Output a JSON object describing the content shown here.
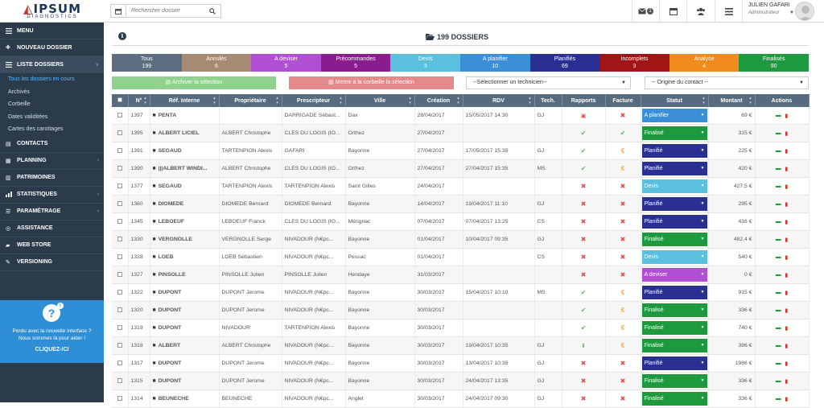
{
  "topbar": {
    "brand": "IPSUM",
    "brand_sub": "DIAGNOSTICS",
    "search_placeholder": "Rechercher dossier",
    "mail_count": "1",
    "user_name": "JULIEN GAFARI",
    "user_role": "Administrateur"
  },
  "sidebar": {
    "items": [
      {
        "label": "MENU",
        "icon": "menu-icon"
      },
      {
        "label": "NOUVEAU DOSSIER",
        "icon": "plus-icon"
      },
      {
        "label": "LISTE DOSSIERS",
        "icon": "list-icon"
      },
      {
        "label": "CONTACTS",
        "icon": "contact-icon"
      },
      {
        "label": "PLANNING",
        "icon": "calendar-icon"
      },
      {
        "label": "PATRIMOINES",
        "icon": "building-icon"
      },
      {
        "label": "STATISTIQUES",
        "icon": "chart-icon"
      },
      {
        "label": "PARAMÉTRAGE",
        "icon": "sliders-icon"
      },
      {
        "label": "ASSISTANCE",
        "icon": "lifebuoy-icon"
      },
      {
        "label": "WEB STORE",
        "icon": "cart-icon"
      },
      {
        "label": "VERSIONING",
        "icon": "wrench-icon"
      }
    ],
    "sub_items": [
      "Tous les dossiers en cours",
      "Archivés",
      "Corbeille",
      "Dates validitées",
      "Cartes des carottages"
    ],
    "help_line1": "Perdu avec la nouvelle interface ?",
    "help_line2": "Nous sommes là pour aider !",
    "help_cta": "CLIQUEZ-ICI"
  },
  "main": {
    "heading": "199 DOSSIERS",
    "archive_label": "Archiver la sélection",
    "trash_label": "Mettre à la corbeille la sélection",
    "tech_select": "--Sélectionner un technicien--",
    "origin_select": "-- Origine du contact --"
  },
  "statuses": [
    {
      "label": "Tous",
      "count": "199",
      "color": "#5d6e80"
    },
    {
      "label": "Annulés",
      "count": "6",
      "color": "#a68b72"
    },
    {
      "label": "A deviser",
      "count": "5",
      "color": "#b14fd4"
    },
    {
      "label": "Précommandes",
      "count": "5",
      "color": "#8a1c8f"
    },
    {
      "label": "Devis",
      "count": "3",
      "color": "#5bc0de"
    },
    {
      "label": "A planifier",
      "count": "10",
      "color": "#3a8fd8"
    },
    {
      "label": "Planifiés",
      "count": "69",
      "color": "#2a2f93"
    },
    {
      "label": "Incomplets",
      "count": "3",
      "color": "#a01616"
    },
    {
      "label": "Analyse",
      "count": "4",
      "color": "#f28b1e"
    },
    {
      "label": "Finalisés",
      "count": "90",
      "color": "#1c9a3d"
    }
  ],
  "columns": [
    "",
    "N°",
    "Réf. Interne",
    "Propriétaire",
    "Prescripteur",
    "Ville",
    "Création",
    "RDV",
    "Tech.",
    "Rapports",
    "Facture",
    "Statut",
    "Montant",
    "Actions"
  ],
  "rows": [
    {
      "num": "1397",
      "ref": "PENTA",
      "prop": "",
      "presc": "DARRIGADE Sébast...",
      "ville": "Dax",
      "creation": "28/04/2017",
      "rdv": "15/05/2017 14:30",
      "tech": "GJ",
      "rapport": "lock",
      "facture": "x",
      "statut": "A planifier",
      "scolor": "#3a8fd8",
      "montant": "69 €"
    },
    {
      "num": "1395",
      "ref": "ALBERT LICIEL",
      "prop": "ALBERT Christophe",
      "presc": "CLES DU LOGIS (IO...",
      "ville": "Orthez",
      "creation": "27/04/2017",
      "rdv": "",
      "tech": "",
      "rapport": "ok",
      "facture": "ok",
      "statut": "Finalisé",
      "scolor": "#1c9a3d",
      "montant": "315 €"
    },
    {
      "num": "1391",
      "ref": "SEGAUD",
      "prop": "TARTENPION Alexis",
      "presc": "GAFARI",
      "ville": "Bayonne",
      "creation": "27/04/2017",
      "rdv": "17/05/2017 15:35",
      "tech": "GJ",
      "rapport": "ok",
      "facture": "euro",
      "statut": "Planifié",
      "scolor": "#2a2f93",
      "montant": "225 €"
    },
    {
      "num": "1390",
      "ref": "|||ALBERT WINDI...",
      "prop": "ALBERT Christophe",
      "presc": "CLES DU LOGIS (IO...",
      "ville": "Orthez",
      "creation": "27/04/2017",
      "rdv": "27/04/2017 15:35",
      "tech": "MS",
      "rapport": "ok",
      "facture": "euro",
      "statut": "Planifié",
      "scolor": "#2a2f93",
      "montant": "420 €"
    },
    {
      "num": "1377",
      "ref": "SEGAUD",
      "prop": "TARTENPION Alexis",
      "presc": "TARTENPION Alexis",
      "ville": "Saint Gilles",
      "creation": "24/04/2017",
      "rdv": "",
      "tech": "",
      "rapport": "x",
      "facture": "x",
      "statut": "Devis",
      "scolor": "#5bc0de",
      "montant": "427,5 €"
    },
    {
      "num": "1360",
      "ref": "DIOMEDE",
      "prop": "DIOMEDE Bernard",
      "presc": "DIOMEDE Bernard",
      "ville": "Bayonne",
      "creation": "14/04/2017",
      "rdv": "19/04/2017 11:10",
      "tech": "GJ",
      "rapport": "x",
      "facture": "x",
      "statut": "Planifié",
      "scolor": "#2a2f93",
      "montant": "295 €"
    },
    {
      "num": "1345",
      "ref": "LEBOEUF",
      "prop": "LEBOEUF Franck",
      "presc": "CLES DU LOGIS (IO...",
      "ville": "Mérignac",
      "creation": "07/04/2017",
      "rdv": "07/04/2017 13:25",
      "tech": "CS",
      "rapport": "x",
      "facture": "x",
      "statut": "Planifié",
      "scolor": "#2a2f93",
      "montant": "416 €"
    },
    {
      "num": "1330",
      "ref": "VERGNOLLE",
      "prop": "VERGNOLLE Serge",
      "presc": "NIVADOUR (N€pc...",
      "ville": "Bayonne",
      "creation": "01/04/2017",
      "rdv": "10/04/2017 09:35",
      "tech": "GJ",
      "rapport": "x",
      "facture": "x",
      "statut": "Finalisé",
      "scolor": "#1c9a3d",
      "montant": "482,4 €"
    },
    {
      "num": "1328",
      "ref": "LOEB",
      "prop": "LOEB Sébastien",
      "presc": "NIVADOUR (N€pc...",
      "ville": "Pessac",
      "creation": "01/04/2017",
      "rdv": "",
      "tech": "CS",
      "rapport": "x",
      "facture": "x",
      "statut": "Devis",
      "scolor": "#5bc0de",
      "montant": "540 €"
    },
    {
      "num": "1327",
      "ref": "PINSOLLE",
      "prop": "PINSOLLE Julien",
      "presc": "PINSOLLE Julien",
      "ville": "Hendaye",
      "creation": "31/03/2017",
      "rdv": "",
      "tech": "",
      "rapport": "x",
      "facture": "x",
      "statut": "A deviser",
      "scolor": "#b14fd4",
      "montant": "0 €"
    },
    {
      "num": "1322",
      "ref": "DUPONT",
      "prop": "DUPONT Jerome",
      "presc": "NIVADOUR (N€pc...",
      "ville": "Bayonne",
      "creation": "30/03/2017",
      "rdv": "15/04/2017 10:10",
      "tech": "MS",
      "rapport": "ok",
      "facture": "euro",
      "statut": "Planifié",
      "scolor": "#2a2f93",
      "montant": "915 €"
    },
    {
      "num": "1320",
      "ref": "DUPONT",
      "prop": "DUPONT Jerome",
      "presc": "NIVADOUR (N€pc...",
      "ville": "Bayonne",
      "creation": "30/03/2017",
      "rdv": "",
      "tech": "",
      "rapport": "ok",
      "facture": "euro",
      "statut": "Finalisé",
      "scolor": "#1c9a3d",
      "montant": "336 €"
    },
    {
      "num": "1319",
      "ref": "DUPONT",
      "prop": "NIVADOUR",
      "presc": "TARTENPION Alexis",
      "ville": "Bayonne",
      "creation": "30/03/2017",
      "rdv": "",
      "tech": "",
      "rapport": "ok",
      "facture": "euro",
      "statut": "Finalisé",
      "scolor": "#1c9a3d",
      "montant": "740 €"
    },
    {
      "num": "1318",
      "ref": "ALBERT",
      "prop": "ALBERT Christophe",
      "presc": "NIVADOUR (N€pc...",
      "ville": "Bayonne",
      "creation": "30/03/2017",
      "rdv": "19/04/2017 10:35",
      "tech": "GJ",
      "rapport": "dl",
      "facture": "euro",
      "statut": "Finalisé",
      "scolor": "#1c9a3d",
      "montant": "396 €"
    },
    {
      "num": "1317",
      "ref": "DUPONT",
      "prop": "DUPONT Jerome",
      "presc": "NIVADOUR (N€pc...",
      "ville": "Bayonne",
      "creation": "30/03/2017",
      "rdv": "13/04/2017 10:35",
      "tech": "GJ",
      "rapport": "x",
      "facture": "x",
      "statut": "Planifié",
      "scolor": "#2a2f93",
      "montant": "1986 €"
    },
    {
      "num": "1315",
      "ref": "DUPONT",
      "prop": "DUPONT Jerome",
      "presc": "NIVADOUR (N€pc...",
      "ville": "Bayonne",
      "creation": "30/03/2017",
      "rdv": "24/04/2017 13:35",
      "tech": "GJ",
      "rapport": "x",
      "facture": "x",
      "statut": "Finalisé",
      "scolor": "#1c9a3d",
      "montant": "336 €"
    },
    {
      "num": "1314",
      "ref": "BEUNECHE",
      "prop": "BEUNECHE",
      "presc": "NIVADOUR (N€pc...",
      "ville": "Anglet",
      "creation": "30/03/2017",
      "rdv": "24/04/2017 09:30",
      "tech": "GJ",
      "rapport": "x",
      "facture": "x",
      "statut": "Finalisé",
      "scolor": "#1c9a3d",
      "montant": "336 €"
    }
  ]
}
